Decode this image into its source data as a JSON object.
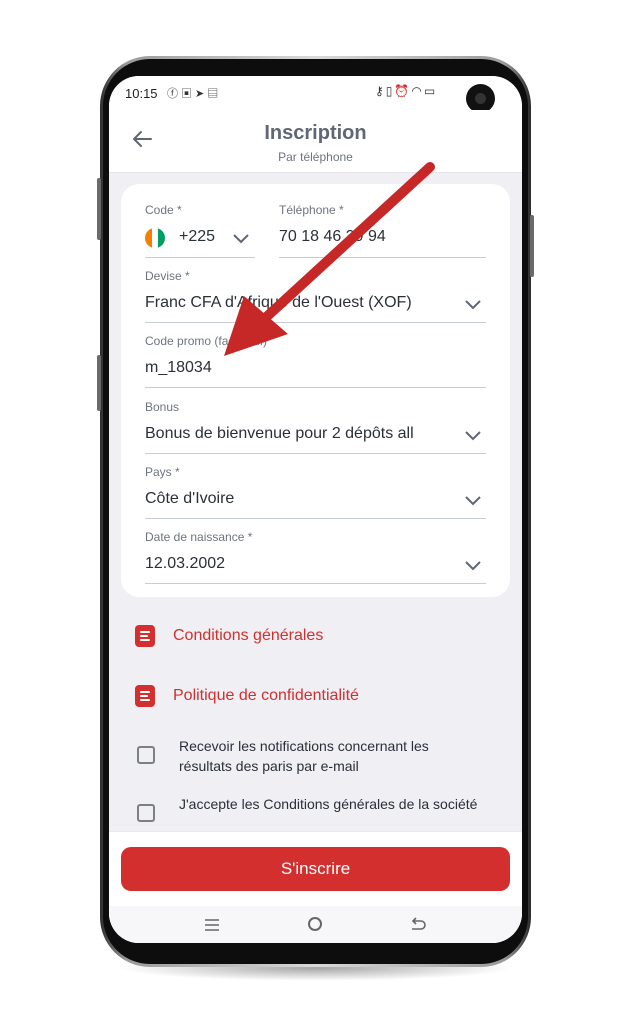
{
  "status_bar": {
    "time": "10:15",
    "left_icons": [
      "facebook-icon",
      "messenger-icon",
      "telegram-icon",
      "linkedin-icon"
    ],
    "right_icons": [
      "key-icon",
      "vibrate-icon",
      "alarm-icon",
      "wifi-icon",
      "battery-icon"
    ]
  },
  "header": {
    "title": "Inscription",
    "subtitle": "Par téléphone"
  },
  "form": {
    "code": {
      "label": "Code *",
      "value": "+225",
      "flag": "cote-divoire-flag-icon"
    },
    "phone": {
      "label": "Téléphone *",
      "value": "70 18 46 39 94"
    },
    "currency": {
      "label": "Devise *",
      "value": "Franc CFA d'Afrique de l'Ouest (XOF)"
    },
    "promo": {
      "label": "Code promo (facultatif)",
      "value": "m_18034"
    },
    "bonus": {
      "label": "Bonus",
      "value": "Bonus de bienvenue pour 2 dépôts all"
    },
    "country": {
      "label": "Pays *",
      "value": "Côte d'Ivoire"
    },
    "birthdate": {
      "label": "Date de naissance *",
      "value": "12.03.2002"
    }
  },
  "links": {
    "terms": "Conditions générales",
    "privacy": "Politique de confidentialité"
  },
  "checkboxes": {
    "notifications": "Recevoir les notifications concernant les résultats des paris par e-mail",
    "accept_terms": "J'accepte les Conditions générales de la société"
  },
  "register_button": "S'inscrire",
  "colors": {
    "accent": "#d32f2f",
    "background": "#efeff4",
    "card": "#ffffff",
    "arrow": "#c62828"
  }
}
